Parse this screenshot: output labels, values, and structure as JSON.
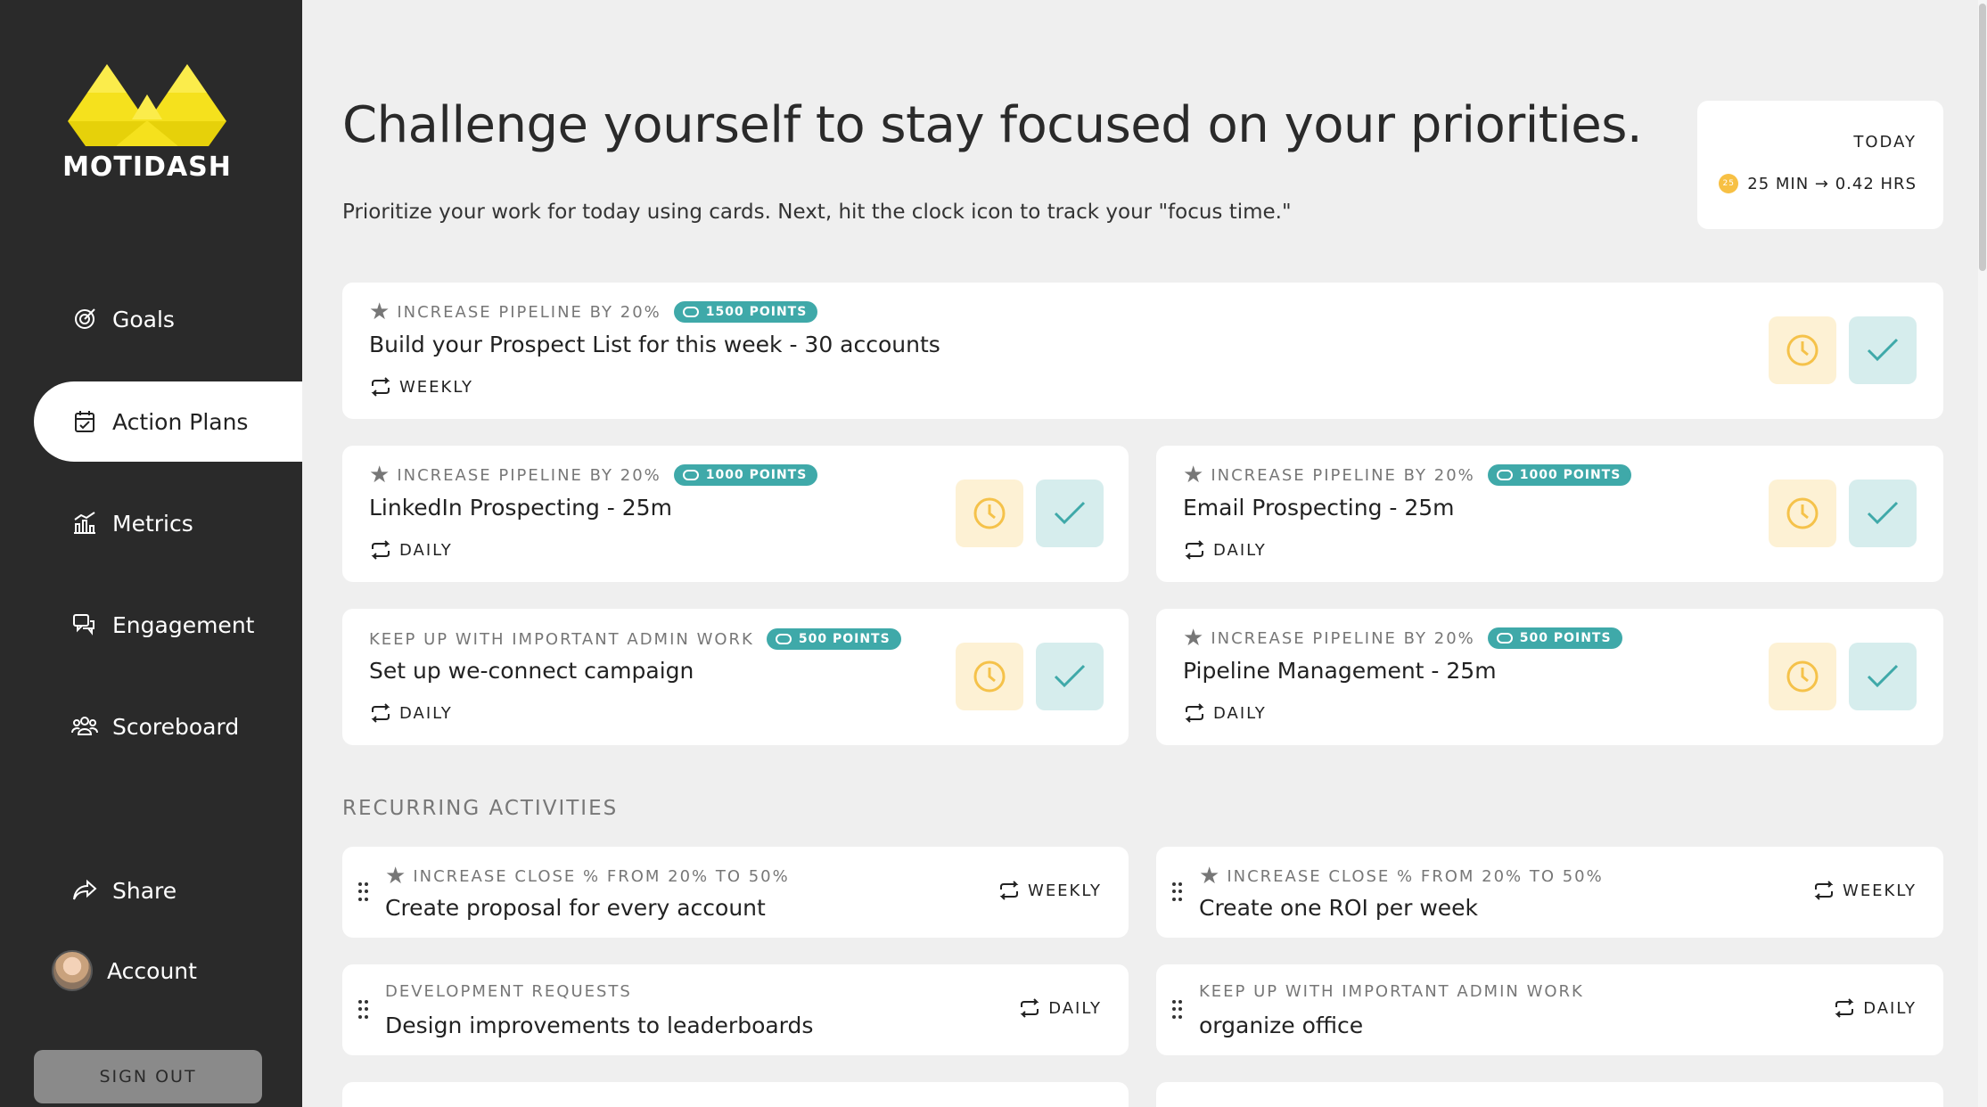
{
  "brand": {
    "name": "MOTIDASH",
    "logo_color": "#f5e11d"
  },
  "sidebar": {
    "items": [
      {
        "label": "Goals",
        "icon": "target-icon"
      },
      {
        "label": "Action Plans",
        "icon": "calendar-check-icon"
      },
      {
        "label": "Metrics",
        "icon": "chart-icon"
      },
      {
        "label": "Engagement",
        "icon": "chat-icon"
      },
      {
        "label": "Scoreboard",
        "icon": "people-icon"
      }
    ],
    "share": "Share",
    "account": "Account",
    "sign_out": "SIGN OUT"
  },
  "header": {
    "title": "Challenge yourself to stay focused on your priorities.",
    "subtitle": "Prioritize your work for today using cards. Next, hit the clock icon to track your \"focus time.\""
  },
  "today": {
    "label": "TODAY",
    "coin": "25",
    "value": "25 MIN → 0.42 HRS"
  },
  "cards": [
    {
      "goal": "INCREASE PIPELINE BY 20%",
      "points": "1500 POINTS",
      "title": "Build your Prospect List for this week - 30 accounts",
      "freq": "WEEKLY"
    },
    {
      "goal": "INCREASE PIPELINE BY 20%",
      "points": "1000 POINTS",
      "title": "LinkedIn Prospecting - 25m",
      "freq": "DAILY"
    },
    {
      "goal": "INCREASE PIPELINE BY 20%",
      "points": "1000 POINTS",
      "title": "Email Prospecting - 25m",
      "freq": "DAILY"
    },
    {
      "goal": "KEEP UP WITH IMPORTANT ADMIN WORK",
      "points": "500 POINTS",
      "title": "Set up we-connect campaign",
      "freq": "DAILY"
    },
    {
      "goal": "INCREASE PIPELINE BY 20%",
      "points": "500 POINTS",
      "title": "Pipeline Management - 25m",
      "freq": "DAILY"
    }
  ],
  "recurring": {
    "title": "RECURRING ACTIVITIES",
    "items": [
      {
        "goal": "INCREASE CLOSE % FROM 20% TO 50%",
        "title": "Create proposal for every account",
        "freq": "WEEKLY"
      },
      {
        "goal": "INCREASE CLOSE % FROM 20% TO 50%",
        "title": "Create one ROI per week",
        "freq": "WEEKLY"
      },
      {
        "goal": "DEVELOPMENT REQUESTS",
        "title": "Design improvements to leaderboards",
        "freq": "DAILY"
      },
      {
        "goal": "KEEP UP WITH IMPORTANT ADMIN WORK",
        "title": "organize office",
        "freq": "DAILY"
      }
    ]
  },
  "colors": {
    "sidebar": "#2a2a2a",
    "accent_teal": "#3fa9a9",
    "clock_bg": "#fdf1d4",
    "check_bg": "#d6eded",
    "clock_icon": "#f5c24a"
  }
}
